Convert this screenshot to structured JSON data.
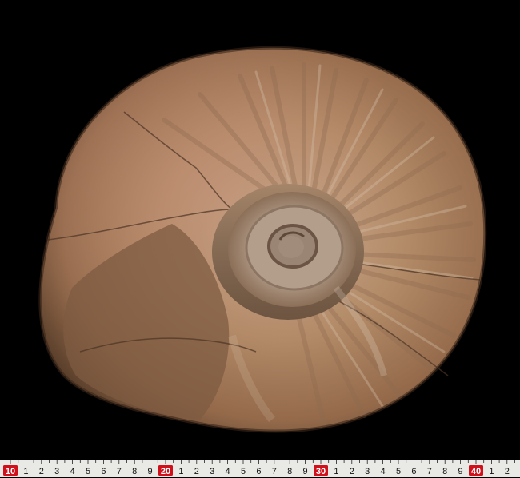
{
  "image": {
    "subject": "ammonite-fossil",
    "background_color": "#000000"
  },
  "ruler": {
    "labels": [
      "10",
      "1",
      "2",
      "3",
      "4",
      "5",
      "6",
      "7",
      "8",
      "9",
      "20",
      "1",
      "2",
      "3",
      "4",
      "5",
      "6",
      "7",
      "8",
      "9",
      "30",
      "1",
      "2",
      "3",
      "4",
      "5",
      "6",
      "7",
      "8",
      "9",
      "40",
      "1",
      "2"
    ],
    "major_labels": [
      "10",
      "20",
      "30",
      "40"
    ],
    "major_color": "#d0101a",
    "background_color": "#e9e9e6"
  }
}
